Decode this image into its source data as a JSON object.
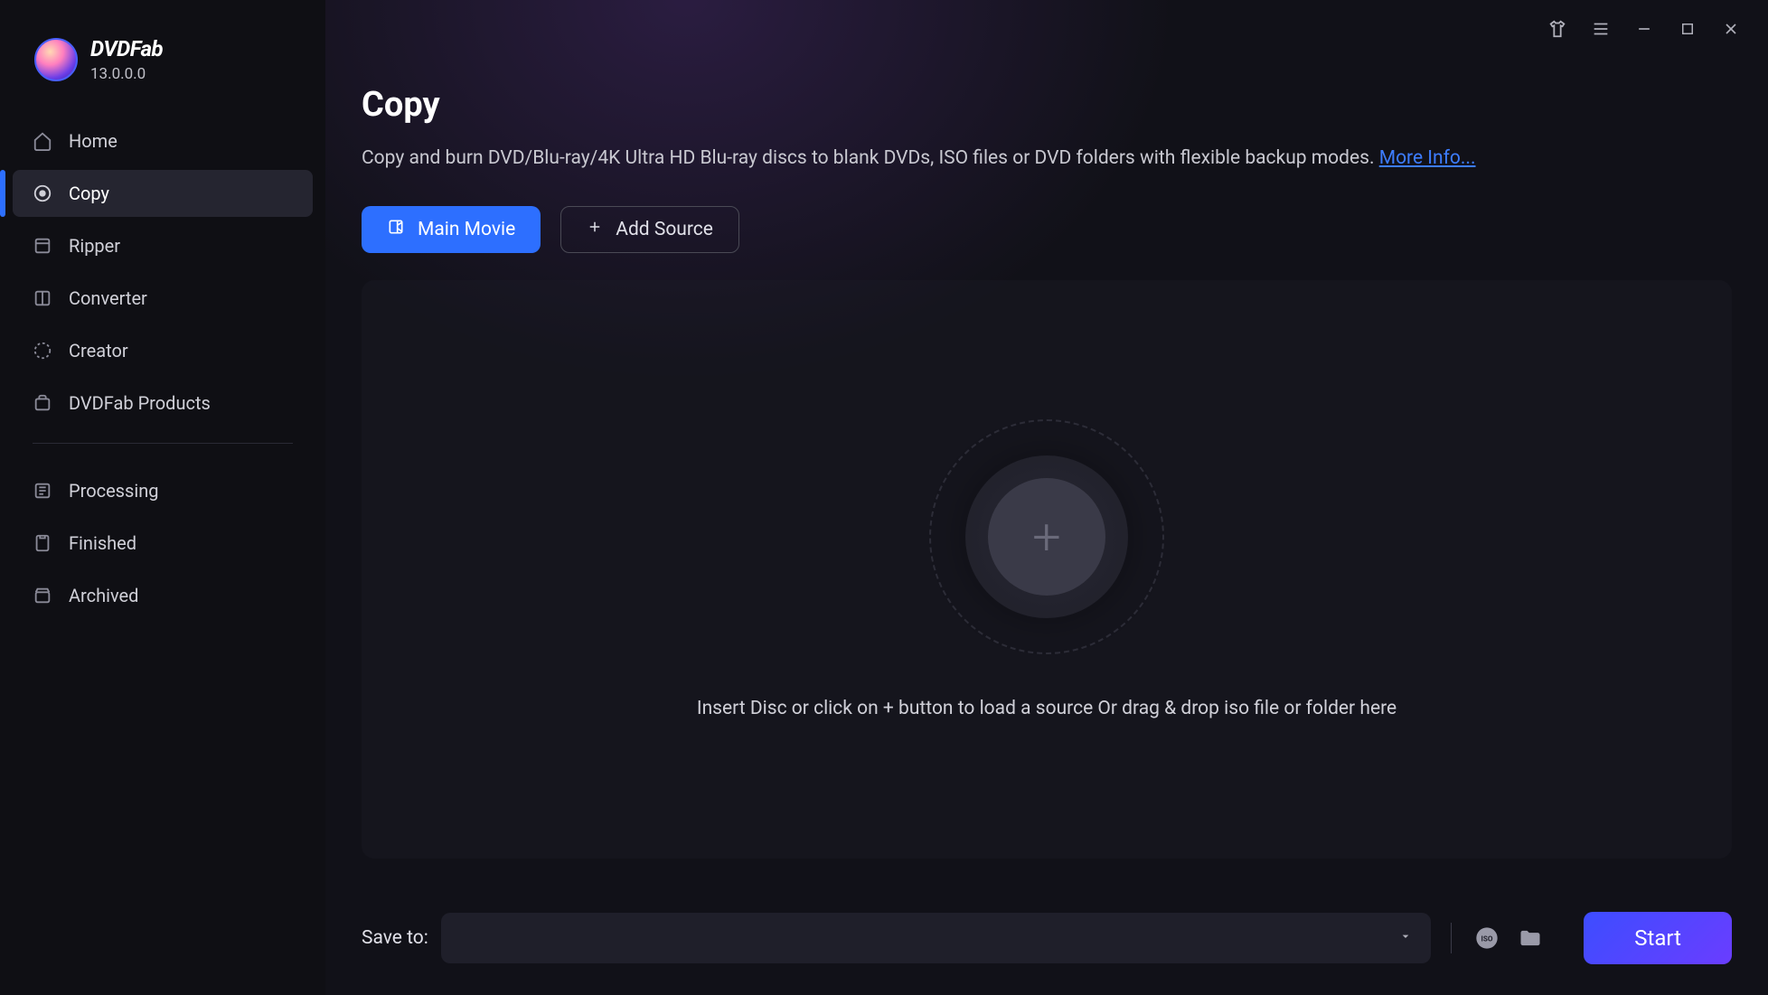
{
  "brand": {
    "name": "DVDFab",
    "version": "13.0.0.0"
  },
  "sidebar": {
    "items": [
      {
        "label": "Home",
        "icon": "home"
      },
      {
        "label": "Copy",
        "icon": "disc",
        "active": true
      },
      {
        "label": "Ripper",
        "icon": "rip"
      },
      {
        "label": "Converter",
        "icon": "convert"
      },
      {
        "label": "Creator",
        "icon": "creator"
      },
      {
        "label": "DVDFab Products",
        "icon": "products"
      }
    ],
    "queue": [
      {
        "label": "Processing",
        "icon": "processing"
      },
      {
        "label": "Finished",
        "icon": "finished"
      },
      {
        "label": "Archived",
        "icon": "archived"
      }
    ]
  },
  "page": {
    "title": "Copy",
    "description": "Copy and burn DVD/Blu-ray/4K Ultra HD Blu-ray discs to blank DVDs, ISO files or DVD folders with flexible backup modes. ",
    "more_info": "More Info..."
  },
  "actions": {
    "main_movie": "Main Movie",
    "add_source": "Add Source"
  },
  "dropzone": {
    "hint": "Insert Disc or click on + button to load a source Or drag & drop iso file or folder here"
  },
  "bottom": {
    "save_to_label": "Save to:",
    "save_to_value": "",
    "start": "Start"
  }
}
